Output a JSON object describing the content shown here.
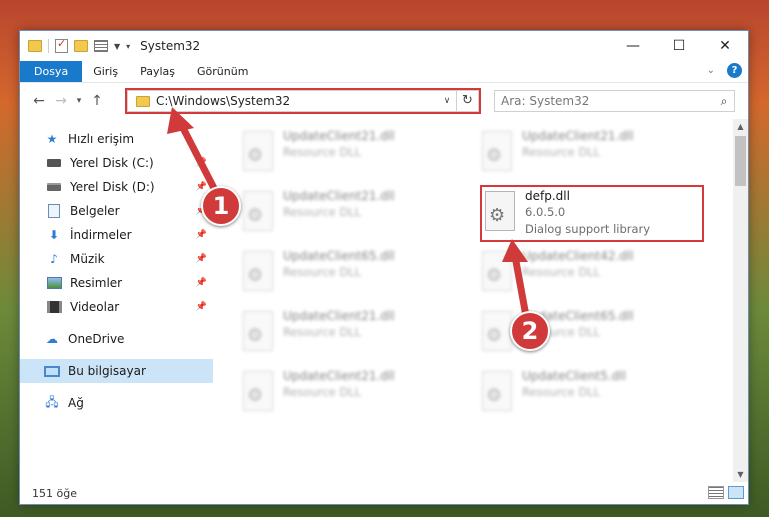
{
  "window": {
    "title": "System32",
    "controls": {
      "minimize": "—",
      "maximize": "☐",
      "close": "✕"
    }
  },
  "ribbon": {
    "tabs": [
      "Dosya",
      "Giriş",
      "Paylaş",
      "Görünüm"
    ]
  },
  "nav": {
    "address": "C:\\Windows\\System32",
    "search_placeholder": "Ara: System32"
  },
  "sidebar": {
    "items": [
      {
        "label": "Hızlı erişim",
        "icon": "star-icon",
        "pinned": false
      },
      {
        "label": "Yerel Disk (C:)",
        "icon": "drive-icon",
        "pinned": true
      },
      {
        "label": "Yerel Disk (D:)",
        "icon": "drive-icon",
        "pinned": true
      },
      {
        "label": "Belgeler",
        "icon": "documents-icon",
        "pinned": true
      },
      {
        "label": "İndirmeler",
        "icon": "download-icon",
        "pinned": true
      },
      {
        "label": "Müzik",
        "icon": "music-icon",
        "pinned": true
      },
      {
        "label": "Resimler",
        "icon": "pictures-icon",
        "pinned": true
      },
      {
        "label": "Videolar",
        "icon": "videos-icon",
        "pinned": true
      },
      {
        "label": "OneDrive",
        "icon": "cloud-icon",
        "pinned": false
      },
      {
        "label": "Bu bilgisayar",
        "icon": "computer-icon",
        "pinned": false
      },
      {
        "label": "Ağ",
        "icon": "network-icon",
        "pinned": false
      }
    ]
  },
  "files": {
    "left": [
      {
        "name": "UpdateClient21.dll",
        "type": "Resource DLL"
      },
      {
        "name": "UpdateClient21.dll",
        "type": "Resource DLL"
      },
      {
        "name": "UpdateClient65.dll",
        "type": "Resource DLL"
      },
      {
        "name": "UpdateClient21.dll",
        "type": "Resource DLL"
      },
      {
        "name": "UpdateClient21.dll",
        "type": "Resource DLL"
      }
    ],
    "right": [
      {
        "name": "UpdateClient21.dll",
        "type": "Resource DLL"
      },
      {
        "name": "UpdateClient42.dll",
        "type": "Resource DLL"
      },
      {
        "name": "UpdateClient65.dll",
        "type": "Resource DLL"
      },
      {
        "name": "UpdateClient5.dll",
        "type": "Resource DLL"
      }
    ],
    "highlighted": {
      "name": "defp.dll",
      "version": "6.0.5.0",
      "description": "Dialog support library"
    }
  },
  "status": {
    "count": "151 öğe"
  },
  "annotations": {
    "step1": "1",
    "step2": "2",
    "highlight_color": "#d43a3a"
  }
}
